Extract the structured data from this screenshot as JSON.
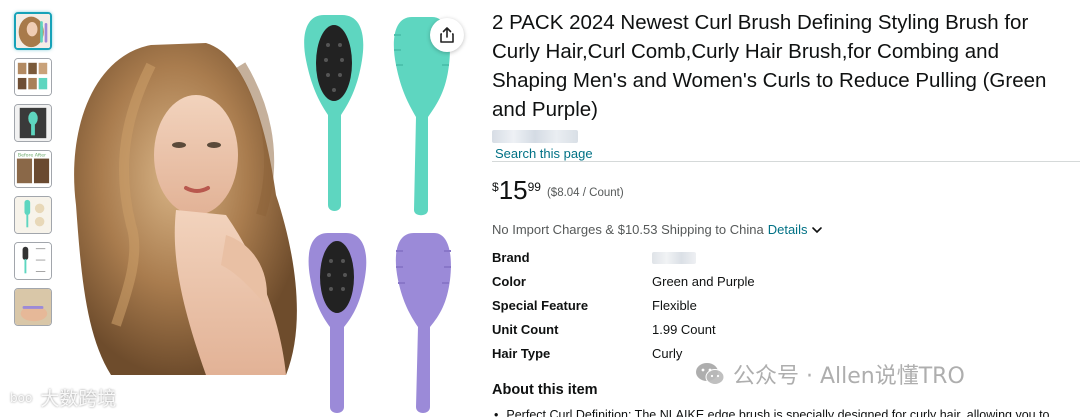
{
  "product": {
    "title": "2 PACK 2024 Newest Curl Brush Defining Styling Brush for Curly Hair,Curl Comb,Curly Hair Brush,for Combing and Shaping Men's and Women's Curls to Reduce Pulling (Green and Purple)",
    "search_link": "Search this page",
    "price": {
      "symbol": "$",
      "whole": "15",
      "fraction": "99",
      "unit_price": "($8.04 / Count)"
    },
    "shipping_text": "No Import Charges & $10.53 Shipping to China",
    "details_link": "Details",
    "specs": [
      {
        "label": "Brand",
        "value": ""
      },
      {
        "label": "Color",
        "value": "Green and Purple"
      },
      {
        "label": "Special Feature",
        "value": "Flexible"
      },
      {
        "label": "Unit Count",
        "value": "1.99 Count"
      },
      {
        "label": "Hair Type",
        "value": "Curly"
      }
    ],
    "about_heading": "About this item",
    "bullet_1": "Perfect Curl Definition: The NLAIKE edge brush is specially designed for curly hair, allowing you to"
  },
  "gallery": {
    "thumbnails": [
      "woman-curly-hair",
      "brush-grid",
      "before-after",
      "brush-closeup",
      "before-after-text",
      "brush-features",
      "brush-dimensions",
      "hand-with-brush"
    ],
    "selected_index": 0
  },
  "watermarks": {
    "left_logo": "boo",
    "left_text": "大数跨境",
    "right_text": "公众号 · Allen说懂TRO"
  },
  "colors": {
    "link": "#007185",
    "brush_green": "#5ed6c0",
    "brush_purple": "#9b8ad8",
    "selected_border": "#17a2b8"
  }
}
